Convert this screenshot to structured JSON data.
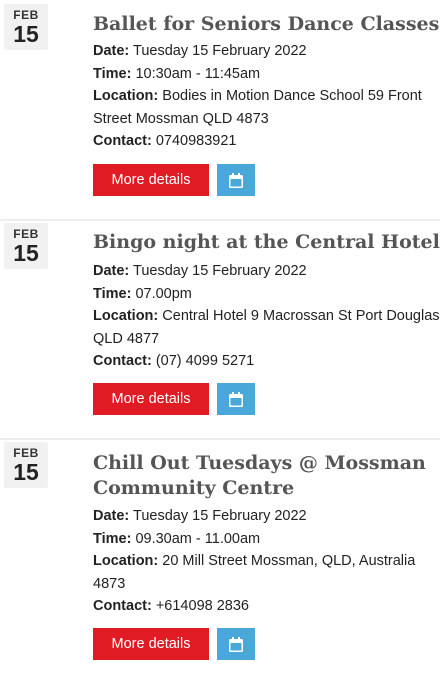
{
  "events": [
    {
      "month": "FEB",
      "day": "15",
      "title": "Ballet for Seniors Dance Classes",
      "date_label": "Date:",
      "date_value": " Tuesday 15 February 2022",
      "time_label": "Time:",
      "time_value": " 10:30am - 11:45am",
      "location_label": "Location:",
      "location_value": " Bodies in Motion Dance School 59 Front Street Mossman QLD 4873",
      "contact_label": "Contact:",
      "contact_value": " 0740983921",
      "more_label": "More details",
      "calendar_icon": "calendar-icon"
    },
    {
      "month": "FEB",
      "day": "15",
      "title": "Bingo night at the Central Hotel",
      "date_label": "Date:",
      "date_value": " Tuesday 15 February 2022",
      "time_label": "Time:",
      "time_value": " 07.00pm",
      "location_label": "Location:",
      "location_value": " Central Hotel 9 Macrossan St Port Douglas QLD 4877",
      "contact_label": "Contact:",
      "contact_value": " (07) 4099 5271",
      "more_label": "More details",
      "calendar_icon": "calendar-icon"
    },
    {
      "month": "FEB",
      "day": "15",
      "title": "Chill Out Tuesdays @ Mossman Community Centre",
      "date_label": "Date:",
      "date_value": " Tuesday 15 February 2022",
      "time_label": "Time:",
      "time_value": " 09.30am - 11.00am",
      "location_label": "Location:",
      "location_value": " 20 Mill Street Mossman, QLD, Australia 4873",
      "contact_label": "Contact:",
      "contact_value": " +614098 2836",
      "more_label": "More details",
      "calendar_icon": "calendar-icon"
    }
  ],
  "colors": {
    "more_button": "#e01b24",
    "calendar_button": "#4aa7da",
    "title": "#555555",
    "badge_bg": "#f1f1f1"
  }
}
